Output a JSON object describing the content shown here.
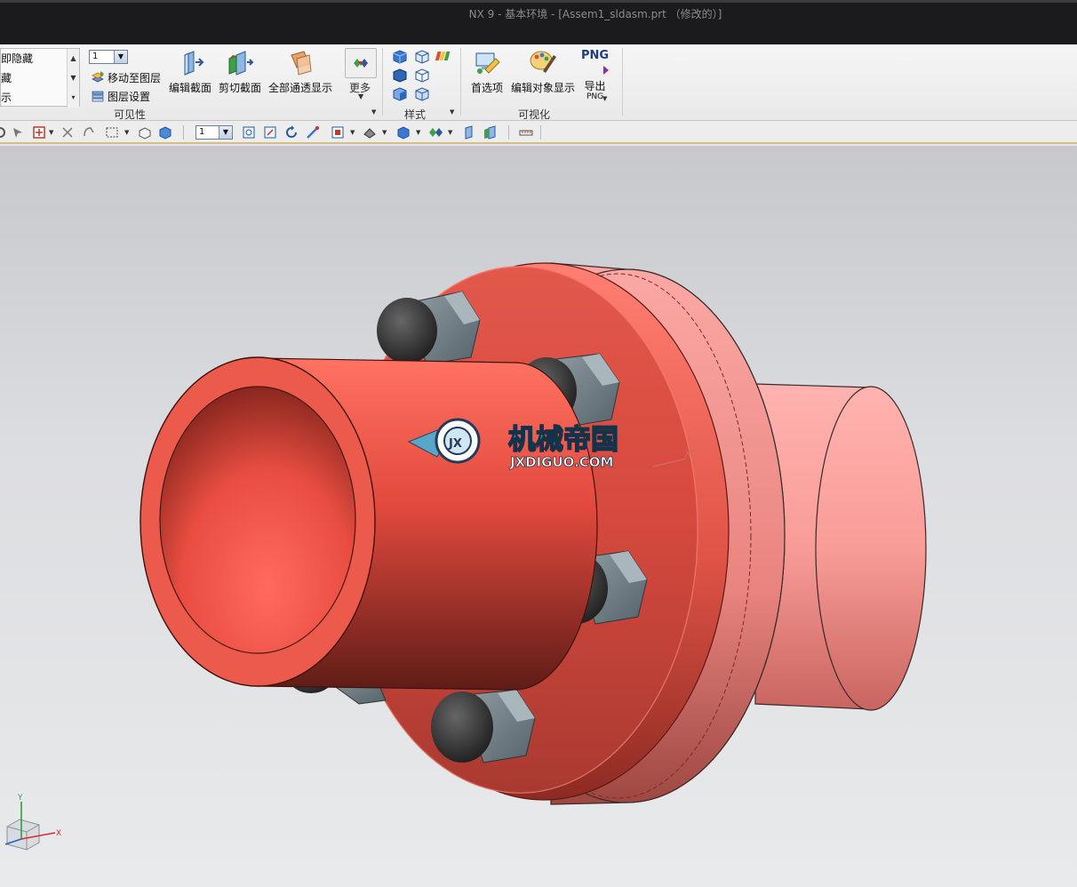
{
  "window": {
    "title": "NX 9 - 基本环境 - [Assem1_sldasm.prt （修改的）]"
  },
  "ribbon": {
    "visibility_list": [
      "即隐藏",
      "藏",
      "示"
    ],
    "layer_combo_value": "1",
    "move_to_layer": "移动至图层",
    "layer_settings": "图层设置",
    "group_visibility": "可见性",
    "edit_section": "编辑截面",
    "clip_section": "剪切截面",
    "all_transparent": "全部通透显示",
    "more": "更多",
    "group_style": "样式",
    "preferences": "首选项",
    "edit_object_display": "编辑对象显示",
    "png_label": "PNG",
    "export": "导出",
    "export_sub": "PNG",
    "group_visualization": "可视化"
  },
  "toolbar": {
    "layer_combo_value": "1"
  },
  "viewport": {
    "watermark_cn": "机械帝国",
    "watermark_url": "JXDIGUO.COM",
    "watermark_badge": "JX",
    "wcs_x_label": "XC",
    "triad_x": "X",
    "triad_y": "Y"
  },
  "colors": {
    "part_red": "#e8574a",
    "part_pink": "#f08f8c",
    "bolt_gray": "#6f7f86",
    "titlebar": "#1b1b1d"
  }
}
